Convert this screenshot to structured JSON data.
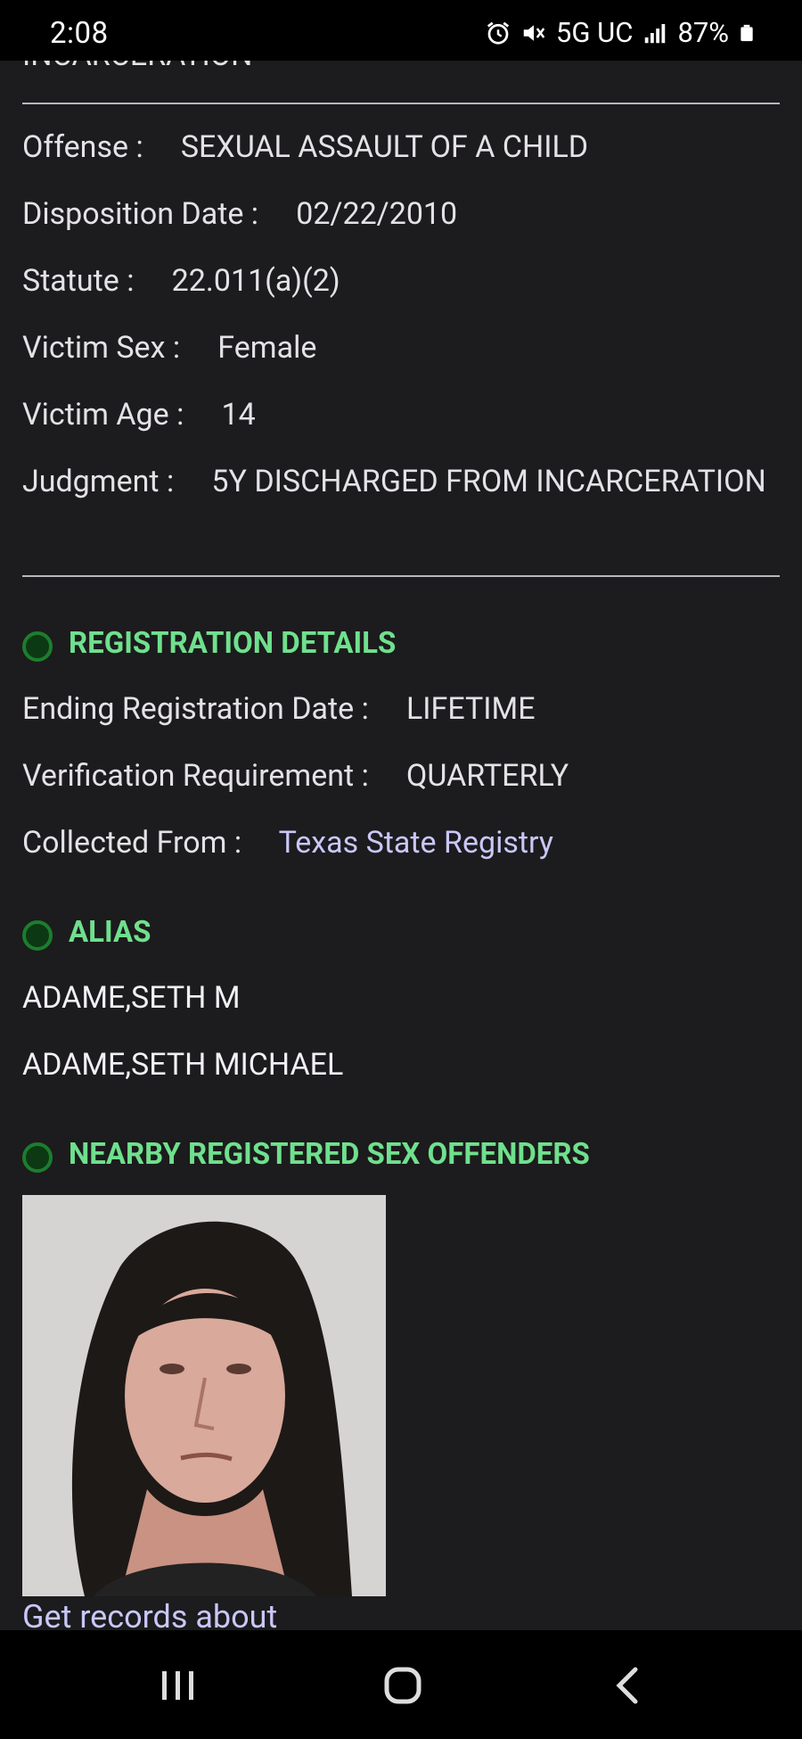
{
  "status_bar": {
    "time": "2:08",
    "network": "5G UC",
    "battery": "87%",
    "icons": [
      "alarm-icon",
      "mute-icon",
      "signal-icon",
      "battery-icon"
    ]
  },
  "top_cut_text": "INCARCERATION",
  "offense": {
    "offense_label": "Offense :",
    "offense_value": "SEXUAL ASSAULT OF A CHILD",
    "disposition_label": "Disposition Date :",
    "disposition_value": "02/22/2010",
    "statute_label": "Statute :",
    "statute_value": "22.011(a)(2)",
    "victim_sex_label": "Victim Sex :",
    "victim_sex_value": "Female",
    "victim_age_label": "Victim Age :",
    "victim_age_value": "14",
    "judgment_label": "Judgment :",
    "judgment_value": "5Y DISCHARGED FROM INCARCERATION"
  },
  "registration": {
    "title": "REGISTRATION DETAILS",
    "ending_label": "Ending Registration Date :",
    "ending_value": "LIFETIME",
    "verification_label": "Verification Requirement :",
    "verification_value": "QUARTERLY",
    "collected_label": "Collected From :",
    "collected_value": "Texas State Registry"
  },
  "alias": {
    "title": "ALIAS",
    "items": [
      "ADAME,SETH M",
      "ADAME,SETH MICHAEL"
    ]
  },
  "nearby": {
    "title": "NEARBY REGISTERED SEX OFFENDERS",
    "link_text": "Get records about"
  },
  "colors": {
    "background": "#1c1b1d",
    "section_title": "#6fe08d",
    "link": "#c9c7f7",
    "bullet_ring": "#1c7d2e"
  }
}
